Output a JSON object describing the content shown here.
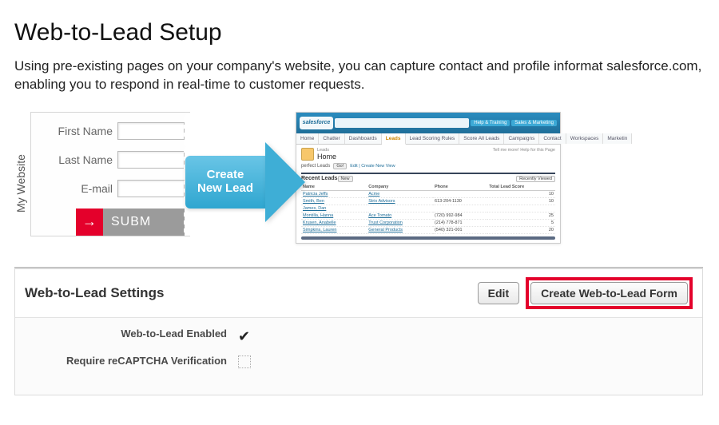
{
  "page": {
    "title": "Web-to-Lead Setup",
    "intro": "Using pre-existing pages on your company's website, you can capture contact and profile informat salesforce.com, enabling you to respond in real-time to customer requests."
  },
  "illustration": {
    "website_label": "My Website",
    "form": {
      "first_name": "First Name",
      "last_name": "Last Name",
      "email": "E-mail",
      "submit": "SUBM"
    },
    "arrow": {
      "line1": "Create",
      "line2": "New Lead"
    },
    "sf": {
      "logo": "salesforce",
      "top_pills": [
        "Help & Training",
        "Sales & Marketing"
      ],
      "tabs": [
        "Home",
        "Chatter",
        "Dashboards",
        "Leads",
        "Lead Scoring Rules",
        "Score All Leads",
        "Campaigns",
        "Contact",
        "Workspaces",
        "Marketin"
      ],
      "active_tab_index": 3,
      "home_small": "Leads",
      "home_big": "Home",
      "right_note": "Tell me more! Help for this Page",
      "view_label": "perfect Leads",
      "go": "Go!",
      "edit_link": "Edit | Create New View",
      "section_title": "Recent Leads",
      "new_btn": "New",
      "recently_viewed": "Recently Viewed",
      "columns": [
        "Name",
        "Company",
        "Phone",
        "Total Lead Score"
      ],
      "rows": [
        {
          "name": "Patricia Jeffs",
          "company": "Acme",
          "phone": "",
          "score": "10"
        },
        {
          "name": "Smith, Ben",
          "company": "Strix Advisors",
          "phone": "613-204-1130",
          "score": "10"
        },
        {
          "name": "James, Dan",
          "company": "",
          "phone": "",
          "score": ""
        },
        {
          "name": "Montilla, Hanna",
          "company": "Ace Tomato",
          "phone": "(720) 992-984",
          "score": "25"
        },
        {
          "name": "Krusen, Anabelle",
          "company": "Trust Corporation",
          "phone": "(214) 778-871",
          "score": "5"
        },
        {
          "name": "Simpkins, Lauren",
          "company": "General Products",
          "phone": "(540) 321-001",
          "score": "20"
        }
      ]
    }
  },
  "settings": {
    "title": "Web-to-Lead Settings",
    "edit_btn": "Edit",
    "create_btn": "Create Web-to-Lead Form",
    "enabled_label": "Web-to-Lead Enabled",
    "recaptcha_label": "Require reCAPTCHA Verification",
    "enabled_value": "✔"
  }
}
